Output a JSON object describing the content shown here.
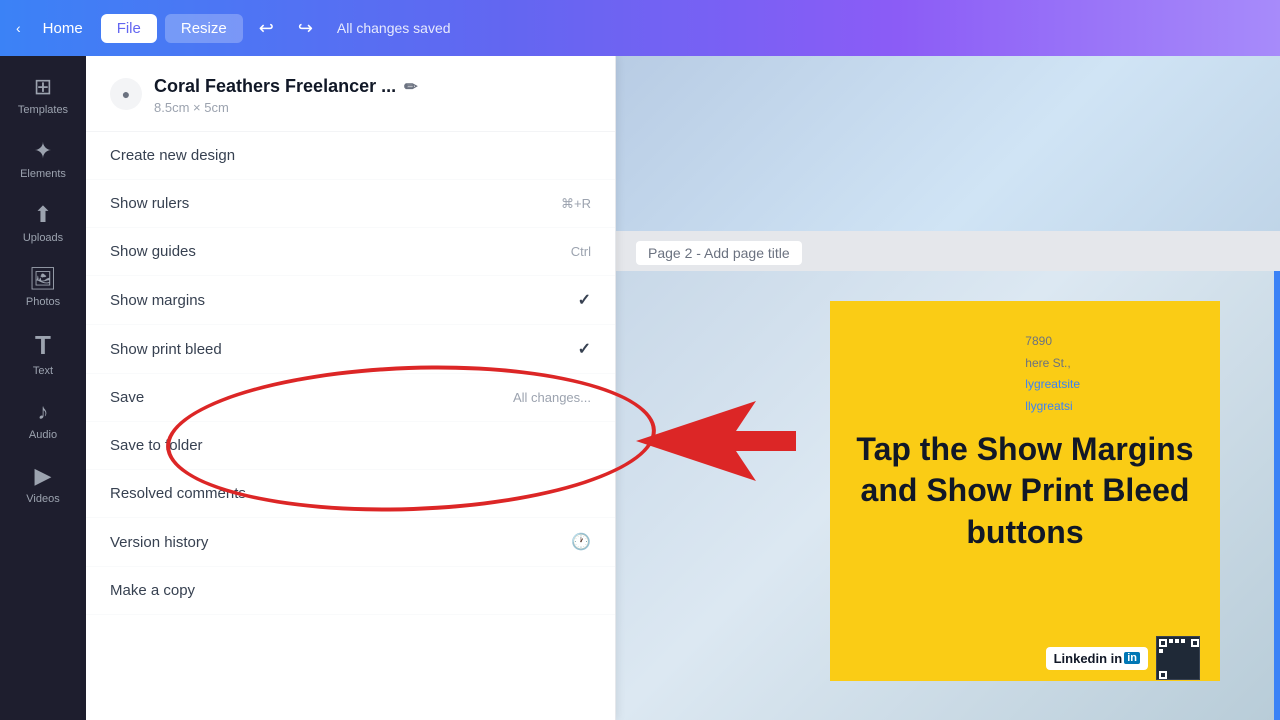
{
  "topbar": {
    "home_label": "Home",
    "file_label": "File",
    "resize_label": "Resize",
    "undo_icon": "↩",
    "redo_icon": "↪",
    "status": "All changes saved"
  },
  "sidebar": {
    "items": [
      {
        "id": "templates",
        "icon": "⊞",
        "label": "Templates"
      },
      {
        "id": "elements",
        "icon": "✦",
        "label": "Elements"
      },
      {
        "id": "uploads",
        "icon": "⬆",
        "label": "Uploads"
      },
      {
        "id": "photos",
        "icon": "🖼",
        "label": "Photos"
      },
      {
        "id": "text",
        "icon": "T",
        "label": "Text"
      },
      {
        "id": "audio",
        "icon": "♪",
        "label": "Audio"
      },
      {
        "id": "videos",
        "icon": "▶",
        "label": "Videos"
      }
    ]
  },
  "dropdown": {
    "close_icon": "○",
    "title": "Coral Feathers Freelancer ...",
    "subtitle": "8.5cm × 5cm",
    "edit_icon": "✏",
    "menu_items": [
      {
        "id": "create-new-design",
        "label": "Create new design",
        "shortcut": "",
        "checked": false
      },
      {
        "id": "show-rulers",
        "label": "Show rulers",
        "shortcut": "⌘+R",
        "checked": false
      },
      {
        "id": "show-guides",
        "label": "Show guides",
        "shortcut": "Ctrl",
        "checked": false
      },
      {
        "id": "show-margins",
        "label": "Show margins",
        "shortcut": "",
        "checked": true
      },
      {
        "id": "show-print-bleed",
        "label": "Show print bleed",
        "shortcut": "",
        "checked": true
      },
      {
        "id": "save",
        "label": "Save",
        "shortcut": "All changes...",
        "checked": false
      },
      {
        "id": "save-to-folder",
        "label": "Save to folder",
        "shortcut": "",
        "checked": false
      },
      {
        "id": "resolved-comments",
        "label": "Resolved comments",
        "shortcut": "",
        "checked": false
      },
      {
        "id": "version-history",
        "label": "Version history",
        "shortcut": "",
        "checked": false,
        "icon": "🕐"
      },
      {
        "id": "make-a-copy",
        "label": "Make a copy",
        "shortcut": "",
        "checked": false
      }
    ]
  },
  "canvas": {
    "page2_label": "Page 2 - Add page title",
    "callout_text": "Tap the Show Margins and Show Print Bleed buttons",
    "linkedin_label": "Linkedin in"
  }
}
